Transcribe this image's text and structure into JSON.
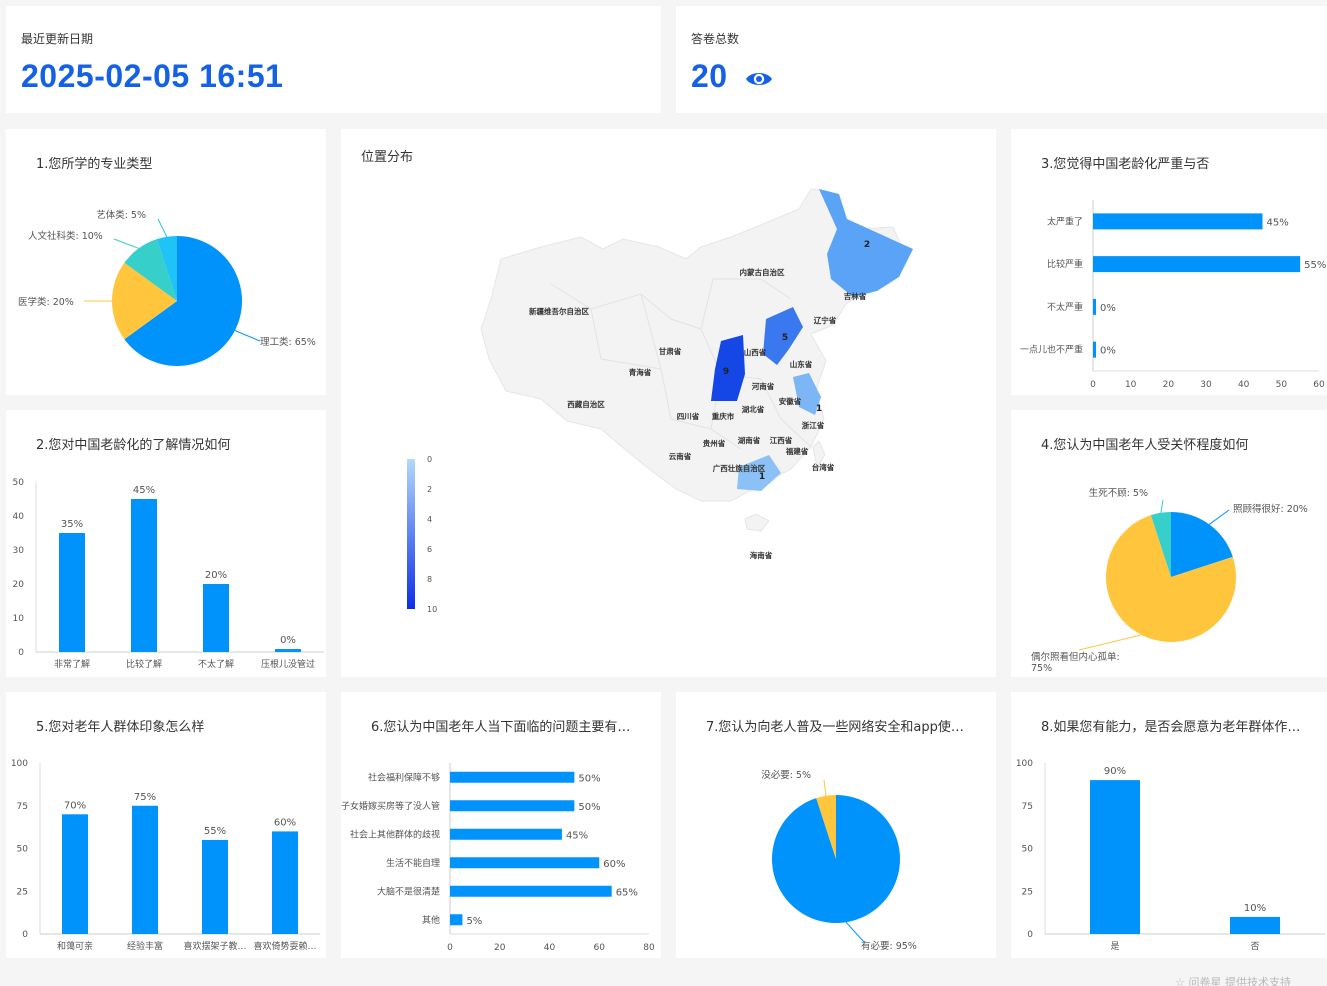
{
  "header": {
    "update_label": "最近更新日期",
    "update_value": "2025-02-05 16:51",
    "count_label": "答卷总数",
    "count_value": "20"
  },
  "icons": {
    "view": "eye-icon",
    "footer": "star-icon"
  },
  "colors": {
    "accent": "#1461e6",
    "blue": "#0093fb",
    "yellow": "#ffc53d",
    "teal": "#36cfc9",
    "cyan": "#1fc3f7"
  },
  "map": {
    "title": "位置分布",
    "provinces": [
      "内蒙古自治区",
      "新疆维吾尔自治区",
      "吉林省",
      "辽宁省",
      "甘肃省",
      "山西省",
      "山东省",
      "青海省",
      "河南省",
      "西藏自治区",
      "安徽省",
      "湖北省",
      "四川省",
      "重庆市",
      "浙江省",
      "贵州省",
      "湖南省",
      "江西省",
      "福建省",
      "云南省",
      "广西壮族自治区",
      "台湾省",
      "海南省"
    ],
    "counts": [
      {
        "province": "吉林省",
        "value": "2"
      },
      {
        "province": "山西省",
        "value": "5"
      },
      {
        "province": "陕西省",
        "value": "9"
      },
      {
        "province": "江苏省",
        "value": "1"
      },
      {
        "province": "广东省",
        "value": "1"
      }
    ],
    "legend": [
      "0",
      "2",
      "4",
      "6",
      "8",
      "10"
    ]
  },
  "chart_data": [
    {
      "id": "q1",
      "type": "pie",
      "title": "1.您所学的专业类型",
      "slices": [
        {
          "label": "理工类: 65%",
          "value": 65,
          "color": "#0093fb"
        },
        {
          "label": "医学类: 20%",
          "value": 20,
          "color": "#ffc53d"
        },
        {
          "label": "人文社科类: 10%",
          "value": 10,
          "color": "#36cfc9"
        },
        {
          "label": "艺体类: 5%",
          "value": 5,
          "color": "#1fc3f7"
        }
      ]
    },
    {
      "id": "q2",
      "type": "bar",
      "title": "2.您对中国老龄化的了解情况如何",
      "categories": [
        "非常了解",
        "比较了解",
        "不太了解",
        "压根儿没管过"
      ],
      "values": [
        35,
        45,
        20,
        0
      ],
      "value_labels": [
        "35%",
        "45%",
        "20%",
        "0%"
      ],
      "ylim": [
        0,
        50
      ],
      "yticks": [
        "0",
        "10",
        "20",
        "30",
        "40",
        "50"
      ]
    },
    {
      "id": "q3",
      "type": "bar",
      "orientation": "horizontal",
      "title": "3.您觉得中国老龄化严重与否",
      "categories": [
        "太严重了",
        "比较严重",
        "不太严重",
        "一点儿也不严重"
      ],
      "values": [
        45,
        55,
        0,
        0
      ],
      "value_labels": [
        "45%",
        "55%",
        "0%",
        "0%"
      ],
      "xlim": [
        0,
        60
      ],
      "xticks": [
        "0",
        "10",
        "20",
        "30",
        "40",
        "50",
        "60"
      ]
    },
    {
      "id": "q4",
      "type": "pie",
      "title": "4.您认为中国老年人受关怀程度如何",
      "slices": [
        {
          "label": "照顾得很好: 20%",
          "value": 20,
          "color": "#0093fb"
        },
        {
          "label": "偶尔照看但内心孤单: 75%",
          "value": 75,
          "color": "#ffc53d"
        },
        {
          "label": "生死不顾: 5%",
          "value": 5,
          "color": "#36cfc9"
        }
      ]
    },
    {
      "id": "q5",
      "type": "bar",
      "title": "5.您对老年人群体印象怎么样",
      "categories": [
        "和蔼可亲",
        "经验丰富",
        "喜欢摆架子教…",
        "喜欢倚势耍赖…"
      ],
      "values": [
        70,
        75,
        55,
        60
      ],
      "value_labels": [
        "70%",
        "75%",
        "55%",
        "60%"
      ],
      "ylim": [
        0,
        100
      ],
      "yticks": [
        "0",
        "25",
        "50",
        "75",
        "100"
      ]
    },
    {
      "id": "q6",
      "type": "bar",
      "orientation": "horizontal",
      "title": "6.您认为中国老年人当下面临的问题主要有…",
      "categories": [
        "社会福利保障不够",
        "子女婚嫁买房等了没人管",
        "社会上其他群体的歧视",
        "生活不能自理",
        "大脑不是很清楚",
        "其他"
      ],
      "values": [
        50,
        50,
        45,
        60,
        65,
        5
      ],
      "value_labels": [
        "50%",
        "50%",
        "45%",
        "60%",
        "65%",
        "5%"
      ],
      "xlim": [
        0,
        80
      ],
      "xticks": [
        "0",
        "20",
        "40",
        "60",
        "80"
      ]
    },
    {
      "id": "q7",
      "type": "pie",
      "title": "7.您认为向老人普及一些网络安全和app使…",
      "slices": [
        {
          "label": "有必要: 95%",
          "value": 95,
          "color": "#0093fb"
        },
        {
          "label": "没必要: 5%",
          "value": 5,
          "color": "#ffc53d"
        }
      ]
    },
    {
      "id": "q8",
      "type": "bar",
      "title": "8.如果您有能力，是否会愿意为老年群体作…",
      "categories": [
        "是",
        "否"
      ],
      "values": [
        90,
        10
      ],
      "value_labels": [
        "90%",
        "10%"
      ],
      "ylim": [
        0,
        100
      ],
      "yticks": [
        "0",
        "25",
        "50",
        "75",
        "100"
      ]
    }
  ],
  "footer": {
    "text": "问卷星 提供技术支持"
  }
}
